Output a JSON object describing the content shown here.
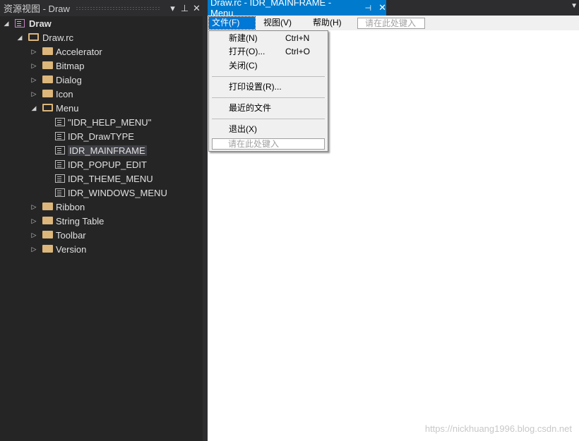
{
  "left_panel": {
    "title": "资源视图 - Draw",
    "buttons": [
      "▾",
      "⊥",
      "✕"
    ],
    "root": "Draw",
    "rc": "Draw.rc",
    "folders_before": [
      "Accelerator",
      "Bitmap",
      "Dialog",
      "Icon"
    ],
    "menu_folder": "Menu",
    "menus": [
      "\"IDR_HELP_MENU\"",
      "IDR_DrawTYPE",
      "IDR_MAINFRAME",
      "IDR_POPUP_EDIT",
      "IDR_THEME_MENU",
      "IDR_WINDOWS_MENU"
    ],
    "folders_after": [
      "Ribbon",
      "String Table",
      "Toolbar",
      "Version"
    ]
  },
  "tab": {
    "title": "Draw.rc - IDR_MAINFRAME - Menu",
    "pin": "⊣",
    "close": "✕"
  },
  "menubar": {
    "items": [
      "文件(F)",
      "视图(V)",
      "帮助(H)"
    ],
    "type_here": "请在此处键入"
  },
  "dropdown": {
    "items": [
      {
        "label": "新建(N)",
        "shortcut": "Ctrl+N"
      },
      {
        "label": "打开(O)...",
        "shortcut": "Ctrl+O"
      },
      {
        "label": "关闭(C)"
      },
      {
        "label": "打印设置(R)..."
      },
      {
        "label": "最近的文件"
      },
      {
        "label": "退出(X)"
      }
    ],
    "type_here": "请在此处键入"
  },
  "watermark": "https://nickhuang1996.blog.csdn.net"
}
